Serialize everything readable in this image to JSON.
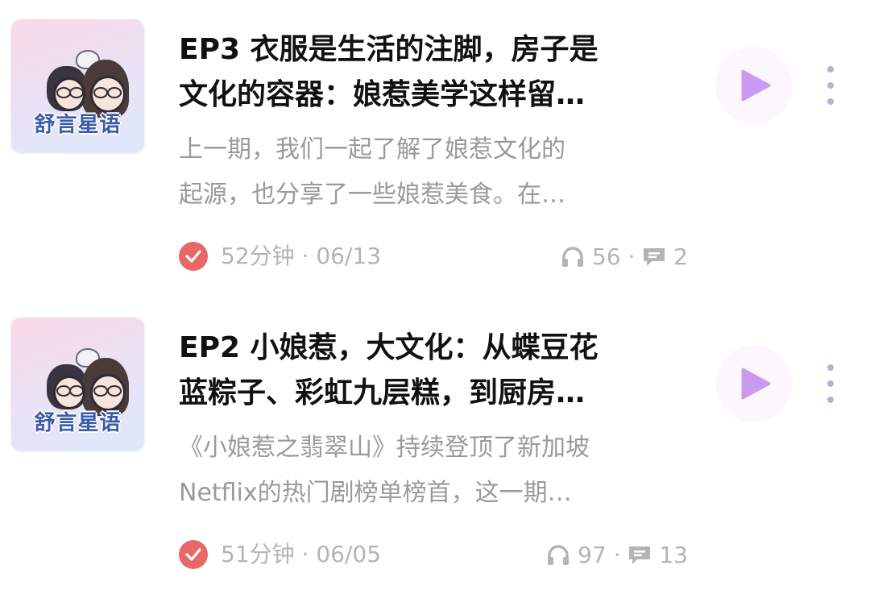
{
  "episodes": [
    {
      "cover_text": "舒言星语",
      "title_line1": "EP3 衣服是生活的注脚，房子是",
      "title_line2": "文化的容器：娘惹美学这样留…",
      "desc_line1": "上一期，我们一起了解了娘惹文化的",
      "desc_line2": "起源，也分享了一些娘惹美食。在…",
      "duration_date": "52分钟 · 06/13",
      "listens": "56",
      "comments": "2"
    },
    {
      "cover_text": "舒言星语",
      "title_line1": "EP2 小娘惹，大文化：从蝶豆花",
      "title_line2": "蓝粽子、彩虹九层糕，到厨房…",
      "desc_line1": "《小娘惹之翡翠山》持续登顶了新加坡",
      "desc_line2": "Netflix的热门剧榜单榜首，这一期…",
      "duration_date": "51分钟 · 06/05",
      "listens": "97",
      "comments": "13"
    }
  ],
  "separator": "·",
  "icons": {
    "played": "check-circle-icon",
    "listens": "headphones-icon",
    "comments": "comment-icon",
    "play": "play-icon",
    "more": "more-vertical-icon"
  },
  "colors": {
    "title": "#111111",
    "description": "#9a9a9a",
    "meta": "#b4b4b4",
    "played_check": "#e86767",
    "play_accent": "#c99af0",
    "more_dots": "#b6b1d6"
  }
}
